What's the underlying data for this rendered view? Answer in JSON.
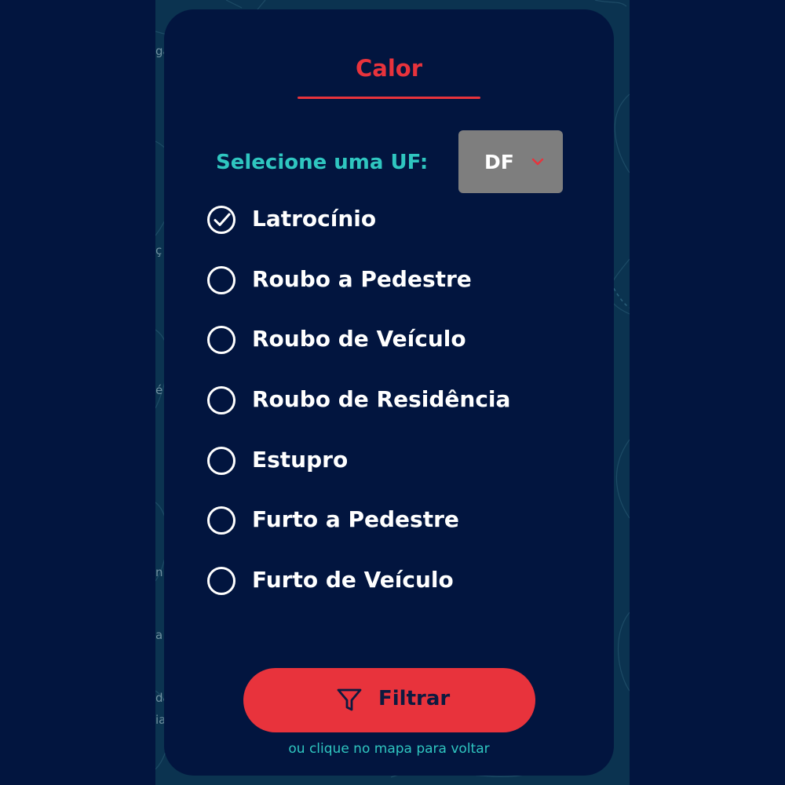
{
  "panel": {
    "title": "Calor"
  },
  "uf_filter": {
    "label": "Selecione uma UF:",
    "selected": "DF"
  },
  "options": [
    {
      "label": "Latrocínio",
      "checked": true
    },
    {
      "label": "Roubo a Pedestre",
      "checked": false
    },
    {
      "label": "Roubo de Veículo",
      "checked": false
    },
    {
      "label": "Roubo de Residência",
      "checked": false
    },
    {
      "label": "Estupro",
      "checked": false
    },
    {
      "label": "Furto a Pedestre",
      "checked": false
    },
    {
      "label": "Furto de Veículo",
      "checked": false
    }
  ],
  "filter_button": {
    "label": "Filtrar",
    "icon": "filter-icon"
  },
  "back_hint": "ou clique no mapa para voltar",
  "map_fragments": [
    "ga",
    "ç",
    "é",
    "n",
    "a",
    "da",
    "ia"
  ],
  "colors": {
    "background": "#02153f",
    "accent_red": "#e8333c",
    "accent_teal": "#2fc6c0",
    "select_gray": "#7e7e7e",
    "map": "#0b3350"
  }
}
